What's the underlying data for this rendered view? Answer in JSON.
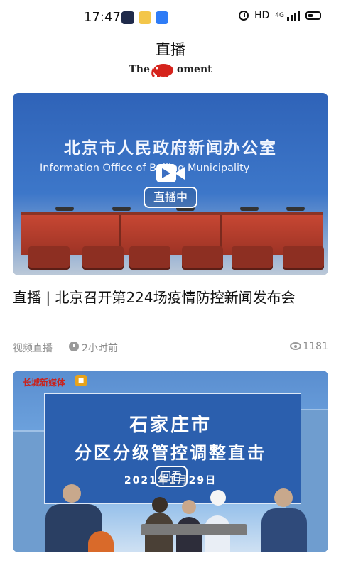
{
  "status_bar": {
    "time": "17:47",
    "hd": "HD",
    "network": "4G"
  },
  "header": {
    "title": "直播",
    "brand_left": "The",
    "brand_right": "oment"
  },
  "articles": [
    {
      "overlay_cn": "北京市人民政府新闻办公室",
      "overlay_en": "Information Office of Beijing Municipality",
      "badge": "直播中",
      "headline": "直播 | 北京召开第224场疫情防控新闻发布会",
      "category": "视频直播",
      "time_ago": "2小时前",
      "views": "1181"
    },
    {
      "logo_text": "长城新媒体",
      "overlay_line1": "石家庄市",
      "overlay_line2": "分区分级管控调整直击",
      "overlay_date": "2021年1月29日",
      "badge": "回看"
    }
  ]
}
